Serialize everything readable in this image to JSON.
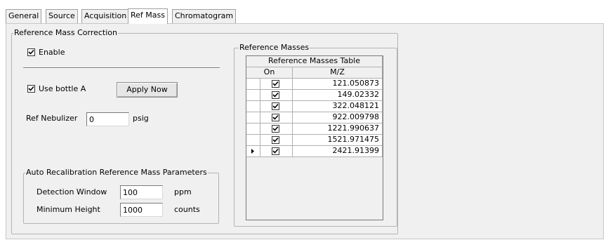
{
  "tabs": [
    {
      "label": "General"
    },
    {
      "label": "Source"
    },
    {
      "label": "Acquisition"
    },
    {
      "label": "Ref Mass"
    },
    {
      "label": "Chromatogram"
    }
  ],
  "active_tab": "Ref Mass",
  "ref_mass_correction": {
    "group_title": "Reference Mass Correction",
    "enable_label": "Enable",
    "enable_checked": true,
    "use_bottle_label": "Use bottle A",
    "use_bottle_checked": true,
    "apply_now_label": "Apply Now",
    "ref_nebulizer_label": "Ref Nebulizer",
    "ref_nebulizer_value": "0",
    "ref_nebulizer_unit": "psig"
  },
  "auto_recal": {
    "group_title": "Auto Recalibration Reference Mass Parameters",
    "detection_window_label": "Detection Window",
    "detection_window_value": "100",
    "detection_window_unit": "ppm",
    "min_height_label": "Minimum Height",
    "min_height_value": "1000",
    "min_height_unit": "counts"
  },
  "reference_masses": {
    "group_title": "Reference Masses",
    "table_title": "Reference Masses Table",
    "col_on": "On",
    "col_mz": "M/Z",
    "rows": [
      {
        "on": true,
        "mz": "121.050873"
      },
      {
        "on": true,
        "mz": "149.02332"
      },
      {
        "on": true,
        "mz": "322.048121"
      },
      {
        "on": true,
        "mz": "922.009798"
      },
      {
        "on": true,
        "mz": "1221.990637"
      },
      {
        "on": true,
        "mz": "1521.971475"
      },
      {
        "on": true,
        "mz": "2421.91399"
      }
    ],
    "current_row_index": 6
  }
}
